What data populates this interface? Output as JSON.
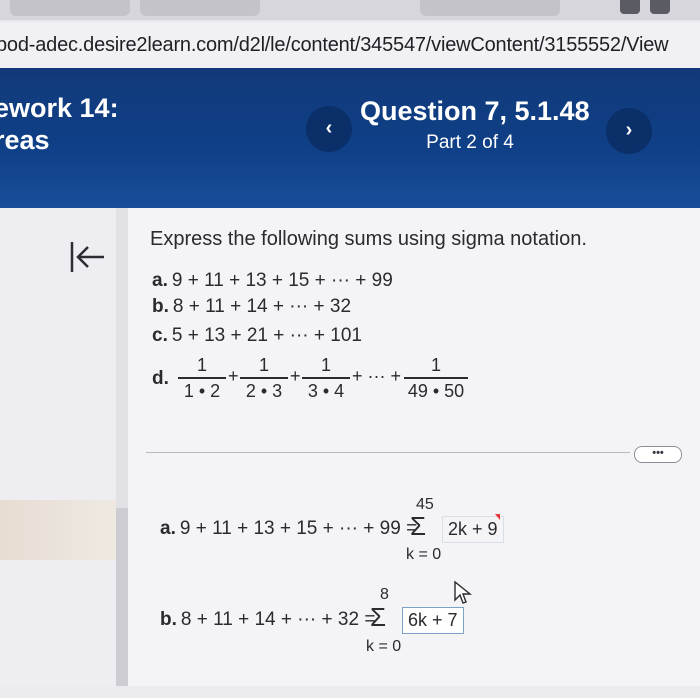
{
  "browser": {
    "url": "pod-adec.desire2learn.com/d2l/le/content/345547/viewContent/3155552/View"
  },
  "header": {
    "title_line1": "ework 14:",
    "title_line2": "reas",
    "question_title": "Question 7, 5.1.48",
    "part": "Part 2 of 4",
    "prev_icon": "‹",
    "next_icon": "›"
  },
  "problem": {
    "prompt": "Express the following sums using sigma notation.",
    "a_label": "a.",
    "a_expr": "9 + 11 + 13 + 15 + ··· + 99",
    "b_label": "b.",
    "b_expr": "8 + 11 + 14 + ··· + 32",
    "c_label": "c.",
    "c_expr": "5 + 13 + 21 + ··· + 101",
    "d_label": "d.",
    "d_fractions": [
      {
        "num": "1",
        "den": "1 • 2"
      },
      {
        "num": "1",
        "den": "2 • 3"
      },
      {
        "num": "1",
        "den": "3 • 4"
      },
      {
        "num": "1",
        "den": "49 • 50"
      }
    ],
    "plus": "+",
    "ellipsis_plus": "+ ··· +"
  },
  "more_label": "•••",
  "answers": {
    "a_label": "a.",
    "a_expr": "9 + 11 + 13 + 15 + ··· + 99 =",
    "a_upper": "45",
    "a_lower": "k = 0",
    "a_value": "2k + 9",
    "b_label": "b.",
    "b_expr": "8 + 11 + 14 + ··· + 32 =",
    "b_upper": "8",
    "b_lower": "k = 0",
    "b_value": "6k + 7",
    "sigma": "Σ"
  },
  "icons": {
    "collapse": "collapse-left-icon",
    "cursor": "mouse-pointer-icon"
  }
}
